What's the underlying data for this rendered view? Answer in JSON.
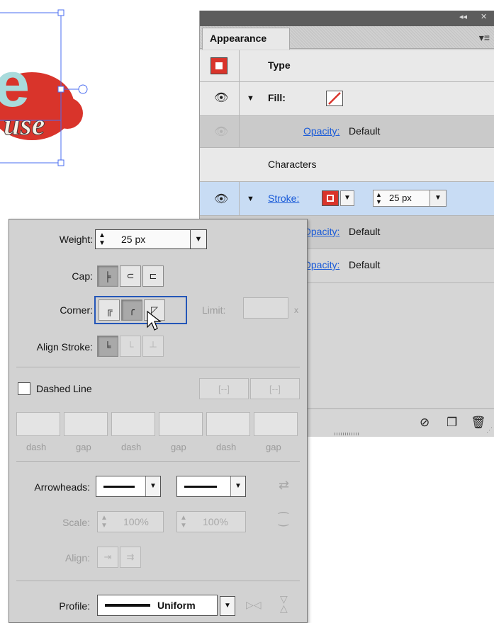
{
  "artwork": {
    "logo_letter": "e",
    "logo_text": "use",
    "fill_color": "#a9dbdc",
    "stroke_color": "#d9342b"
  },
  "appearance": {
    "tab_label": "Appearance",
    "header": {
      "label": "Type"
    },
    "rows": {
      "fill_label": "Fill:",
      "fill_opacity_label": "Opacity:",
      "fill_opacity_value": "Default",
      "characters_label": "Characters",
      "stroke_label": "Stroke:",
      "stroke_weight": "25 px",
      "stroke_opacity_label": "Opacity:",
      "stroke_opacity_value": "Default",
      "char_opacity_value": "Default"
    }
  },
  "stroke_panel": {
    "weight_label": "Weight:",
    "weight_value": "25 px",
    "cap_label": "Cap:",
    "corner_label": "Corner:",
    "limit_label": "Limit:",
    "limit_unit": "x",
    "align_stroke_label": "Align Stroke:",
    "dashed_line_label": "Dashed Line",
    "dash_labels": [
      "dash",
      "gap",
      "dash",
      "gap",
      "dash",
      "gap"
    ],
    "arrowheads_label": "Arrowheads:",
    "scale_label": "Scale:",
    "scale_start": "100%",
    "scale_end": "100%",
    "align_label": "Align:",
    "profile_label": "Profile:",
    "profile_value": "Uniform"
  },
  "colors": {
    "accent_blue": "#1a5bd8",
    "stroke_red": "#d9342b",
    "selection_row": "#c8dcf4"
  }
}
